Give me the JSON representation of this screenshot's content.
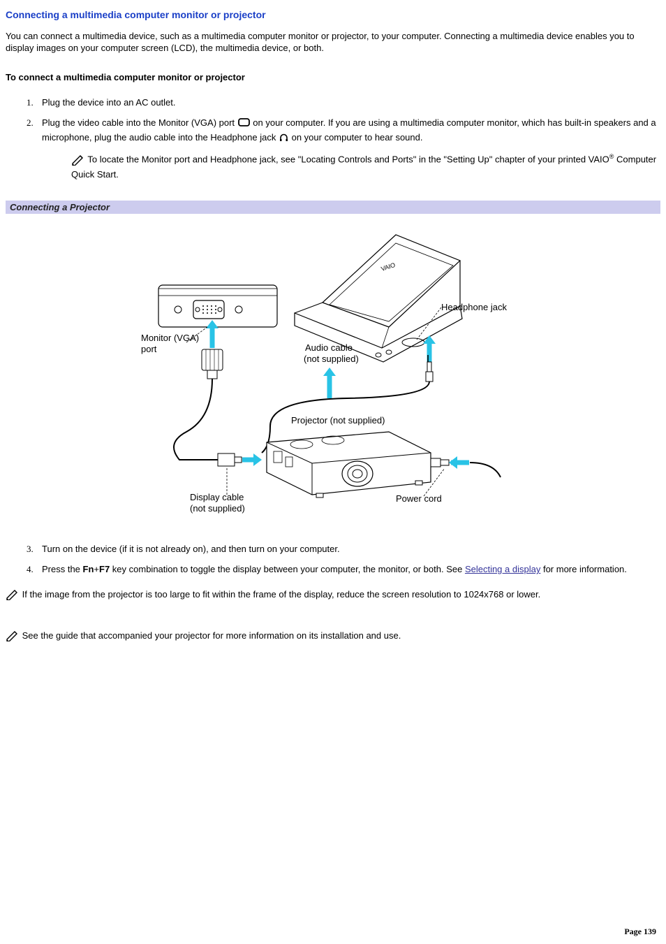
{
  "title": "Connecting a multimedia computer monitor or projector",
  "intro": "You can connect a multimedia device, such as a multimedia computer monitor or projector, to your computer. Connecting a multimedia device enables you to display images on your computer screen (LCD), the multimedia device, or both.",
  "subhead": "To connect a multimedia computer monitor or projector",
  "steps": {
    "s1": {
      "num": "1.",
      "text": "Plug the device into an AC outlet."
    },
    "s2": {
      "num": "2.",
      "pre": "Plug the video cable into the Monitor (VGA) port ",
      "mid": " on your computer. If you are using a multimedia computer monitor, which has built-in speakers and a microphone, plug the audio cable into the Headphone jack ",
      "post": " on your computer to hear sound.",
      "note_pre": " To locate the Monitor port and Headphone jack, see \"Locating Controls and Ports\" in the \"Setting Up\" chapter of your printed VAIO",
      "note_reg": "®",
      "note_post": " Computer Quick Start."
    },
    "s3": {
      "num": "3.",
      "text": "Turn on the device (if it is not already on), and then turn on your computer."
    },
    "s4": {
      "num": "4.",
      "pre": "Press the ",
      "key1": "Fn",
      "plus": "+",
      "key2": "F7",
      "mid": " key combination to toggle the display between your computer, the monitor, or both. See ",
      "link": "Selecting a display",
      "post": " for more information."
    }
  },
  "figure_caption": "Connecting a Projector",
  "figure_labels": {
    "vga": "Monitor (VGA)\nport",
    "audio": "Audio cable\n(not supplied)",
    "headphone": "Headphone jack",
    "projector": "Projector (not supplied)",
    "display_cable": "Display cable\n(not supplied)",
    "power": "Power cord"
  },
  "note_resolution": " If the image from the projector is too large to fit within the frame of the display, reduce the screen resolution to 1024x768 or lower.",
  "note_guide": " See the guide that accompanied your projector for more information on its installation and use.",
  "page_footer": "Page 139"
}
